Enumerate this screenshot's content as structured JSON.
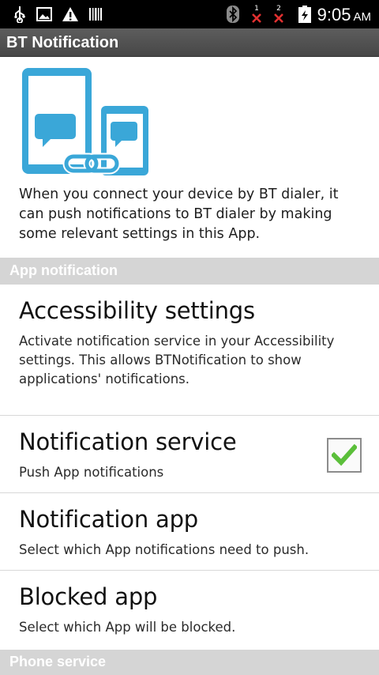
{
  "status_bar": {
    "time": "9:05",
    "ampm": "AM",
    "sim1": "1",
    "sim2": "2",
    "icons": [
      "usb-icon",
      "image-notification-icon",
      "warning-icon",
      "barcode-icon",
      "bluetooth-icon",
      "sim1-no-signal-icon",
      "sim2-no-signal-icon",
      "battery-icon"
    ]
  },
  "title_bar": {
    "title": "BT Notification"
  },
  "intro": {
    "graphic": "phone-link-icon",
    "text": "When you connect your device by BT dialer, it can push notifications to BT dialer by making some relevant settings in this App."
  },
  "sections": {
    "app_notification": "App notification",
    "phone_service": "Phone service"
  },
  "items": {
    "accessibility": {
      "title": "Accessibility settings",
      "summary": "Activate notification service in your Accessibility settings. This allows BTNotification to show applications' notifications."
    },
    "notification_service": {
      "title": "Notification service",
      "summary": "Push App notifications",
      "checked": true
    },
    "notification_app": {
      "title": "Notification app",
      "summary": "Select which App notifications need to push."
    },
    "blocked_app": {
      "title": "Blocked app",
      "summary": "Select which App will be blocked."
    }
  },
  "colors": {
    "accent_blue": "#3aa7d8",
    "check_green": "#5bbf3a",
    "section_bg": "#d5d5d5",
    "title_bar": "#4f4f4f"
  }
}
